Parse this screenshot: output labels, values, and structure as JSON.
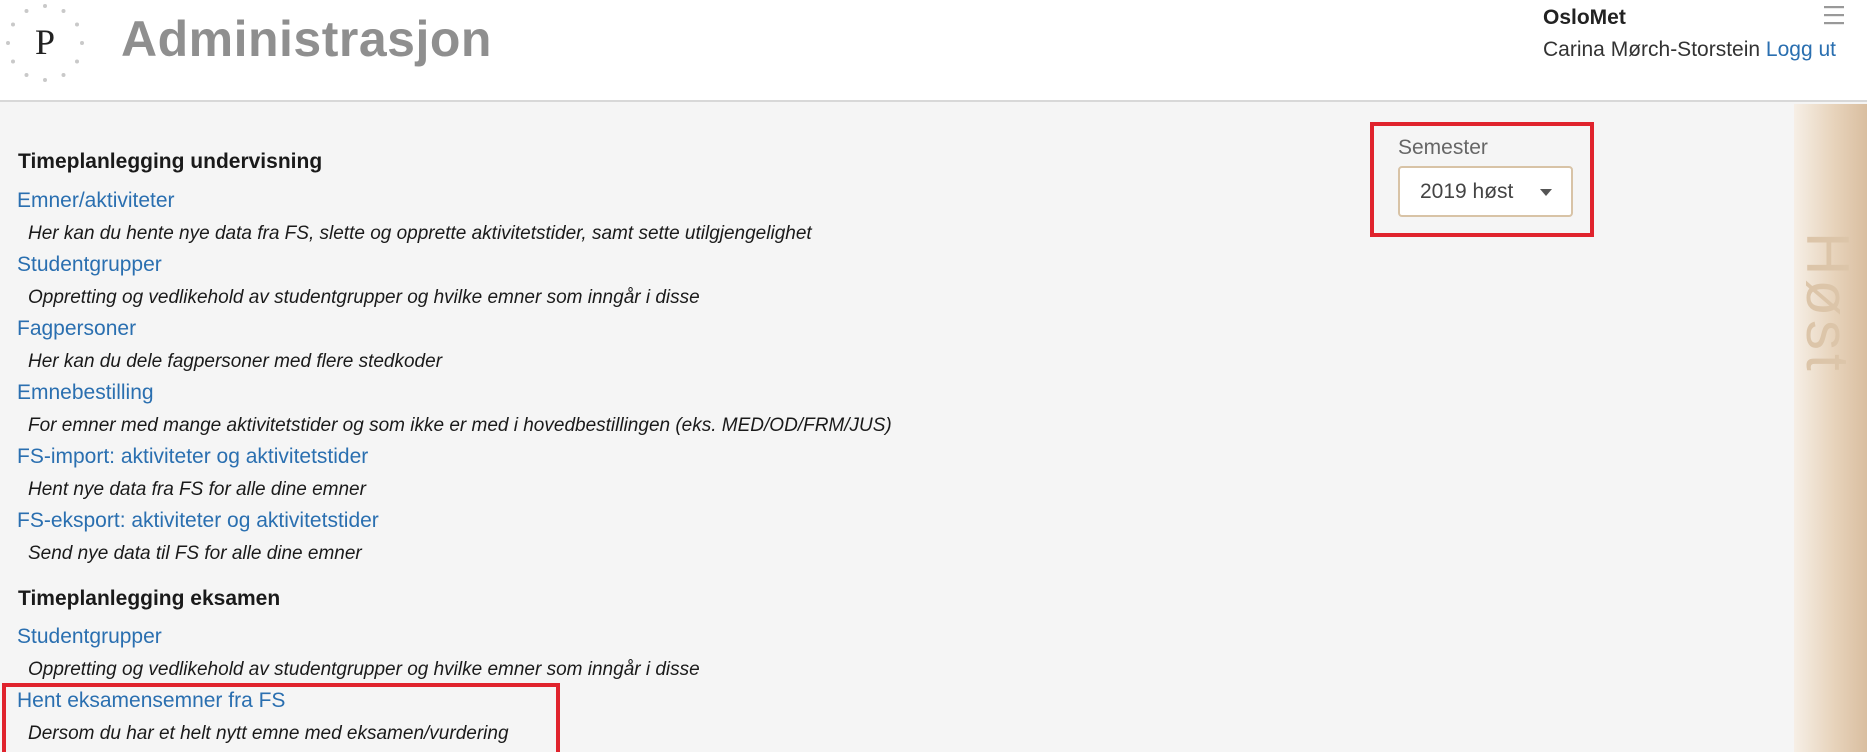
{
  "header": {
    "logo_letter": "P",
    "title": "Administrasjon",
    "organization": "OsloMet",
    "user_name": "Carina Mørch-Storstein",
    "logout_label": "Logg ut",
    "menu_icon": "hamburger-menu-icon"
  },
  "semester": {
    "label": "Semester",
    "selected": "2019 høst"
  },
  "side_banner": {
    "text": "Høst"
  },
  "sections": [
    {
      "title": "Timeplanlegging undervisning",
      "items": [
        {
          "label": "Emner/aktiviteter",
          "description": "Her kan du hente nye data fra FS, slette og opprette aktivitetstider, samt sette utilgjengelighet"
        },
        {
          "label": "Studentgrupper",
          "description": "Oppretting og vedlikehold av studentgrupper og hvilke emner som inngår i disse"
        },
        {
          "label": "Fagpersoner",
          "description": "Her kan du dele fagpersoner med flere stedkoder"
        },
        {
          "label": "Emnebestilling",
          "description": "For emner med mange aktivitetstider og som ikke er med i hovedbestillingen (eks. MED/OD/FRM/JUS)"
        },
        {
          "label": "FS-import: aktiviteter og aktivitetstider",
          "description": "Hent nye data fra FS for alle dine emner"
        },
        {
          "label": "FS-eksport: aktiviteter og aktivitetstider",
          "description": "Send nye data til FS for alle dine emner"
        }
      ]
    },
    {
      "title": "Timeplanlegging eksamen",
      "items": [
        {
          "label": "Studentgrupper",
          "description": "Oppretting og vedlikehold av studentgrupper og hvilke emner som inngår i disse"
        },
        {
          "label": "Hent eksamensemner fra FS",
          "description": "Dersom du har et helt nytt emne med eksamen/vurdering"
        }
      ]
    }
  ],
  "colors": {
    "link": "#2a6fb0",
    "highlight": "#e0232d",
    "title_gray": "#8f8f8f",
    "accent_tan": "#d8c3a6"
  }
}
